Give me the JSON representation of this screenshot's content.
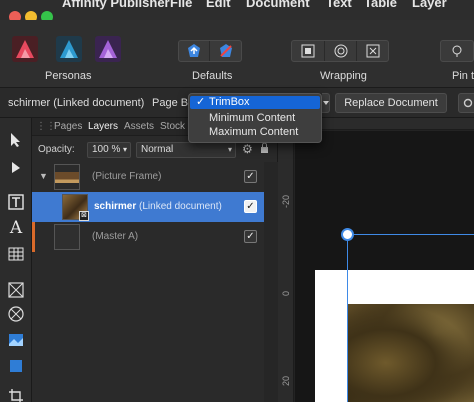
{
  "menubar": {
    "app_name": "Affinity Publisher",
    "items": [
      "File",
      "Edit",
      "Document",
      "Text",
      "Table",
      "Layer"
    ]
  },
  "toolbar": {
    "personas_label": "Personas",
    "defaults_label": "Defaults",
    "wrapping_label": "Wrapping",
    "pin_label": "Pin to"
  },
  "context": {
    "doc_label": "schirmer (Linked document)",
    "page_box_label": "Page Box",
    "replace_button": "Replace Document"
  },
  "page_box_menu": {
    "options": [
      "TrimBox",
      "Minimum Content",
      "Maximum Content"
    ],
    "selected": "TrimBox"
  },
  "panel": {
    "tabs": [
      "Pages",
      "Layers",
      "Assets",
      "Stock"
    ],
    "active_tab": "Layers",
    "opacity_label": "Opacity:",
    "opacity_value": "100 %",
    "blend_mode": "Normal",
    "layers": [
      {
        "name": "(Picture Frame)",
        "checked": true
      },
      {
        "name_bold": "schirmer",
        "name_rest": "(Linked document)",
        "checked": true
      },
      {
        "name": "(Master A)",
        "checked": true
      }
    ]
  },
  "ruler": {
    "labels": [
      "-20",
      "0",
      "20"
    ]
  },
  "colors": {
    "accent": "#1565d6",
    "selection": "#3f7ad1"
  }
}
